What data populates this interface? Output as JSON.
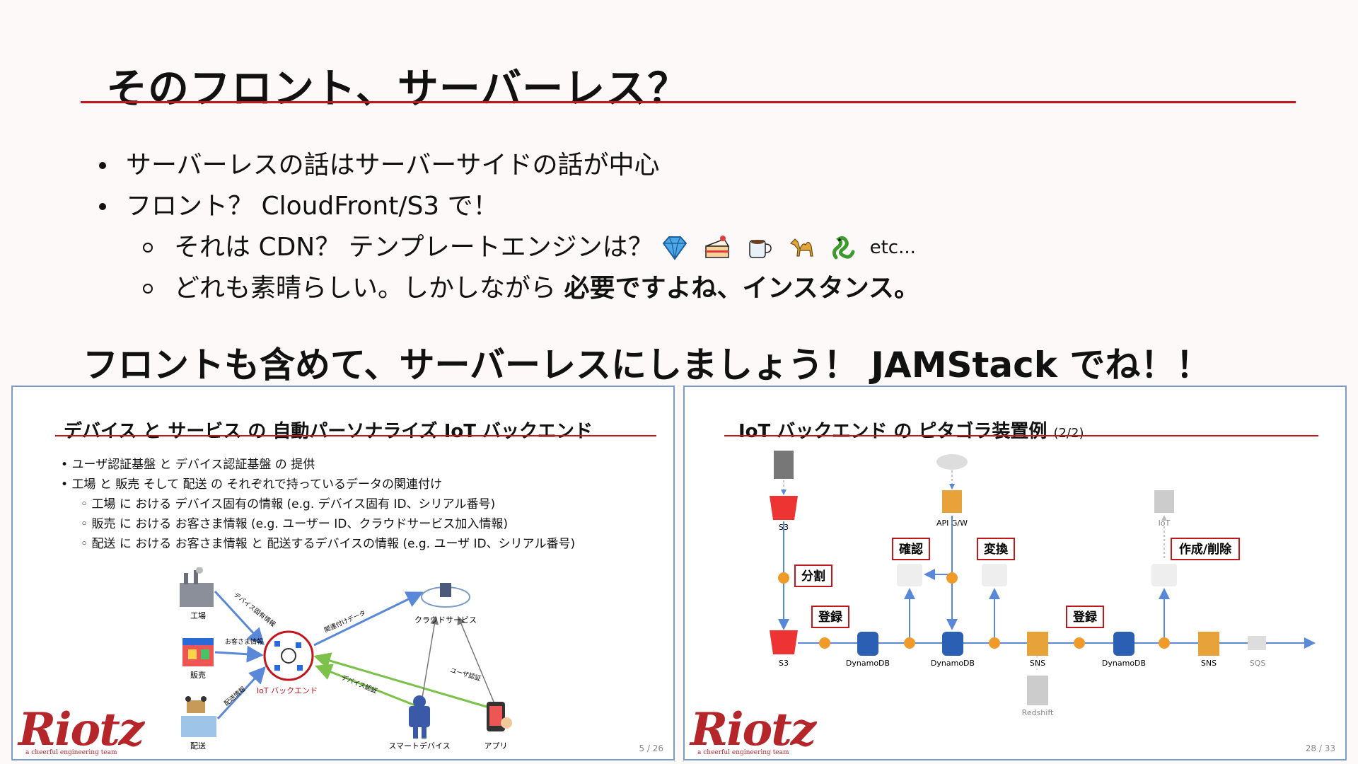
{
  "slide": {
    "title": "そのフロント、サーバーレス？",
    "bullets": [
      "サーバーレスの話はサーバーサイドの話が中心",
      "フロント？ CloudFront/S3 で！"
    ],
    "sub_bullet_1": "それは CDN？ テンプレートエンジンは？",
    "sub_bullet_1_etc": "etc...",
    "emoji_icons": [
      "gem-icon",
      "cake-icon",
      "coffee-icon",
      "camel-icon",
      "snake-icon"
    ],
    "sub_bullet_2_plain": "どれも素晴らしい。しかしながら",
    "sub_bullet_2_bold": "必要ですよね、インスタンス。",
    "headline": "フロントも含めて、サーバーレスにしましょう！ JAMStack でね！！"
  },
  "left_panel": {
    "title": "デバイス と サービス の 自動パーソナライズ IoT バックエンド",
    "bullets": [
      "ユーザ認証基盤 と デバイス認証基盤 の 提供",
      "工場 と 販売 そして 配送 の それぞれで持っているデータの関連付け"
    ],
    "sub_bullets": [
      "工場 に おける デバイス固有の情報 (e.g. デバイス固有 ID、シリアル番号)",
      "販売 に おける お客さま情報 (e.g. ユーザー ID、クラウドサービス加入情報)",
      "配送 に おける お客さま情報 と 配送するデバイスの情報 (e.g. ユーザ ID、シリアル番号)"
    ],
    "diagram": {
      "factory": "工場",
      "sales": "販売",
      "delivery": "配送",
      "backend": "IoT バックエンド",
      "cloud": "クラウドサービス",
      "smart_device": "スマートデバイス",
      "app": "アプリ",
      "edge_device_info": "デバイス固有情報",
      "edge_customer_info": "お客さま情報",
      "edge_delivery_info": "配送情報",
      "edge_assoc": "関連付けデータ",
      "edge_device_auth": "デバイス認証",
      "edge_user_auth": "ユーザ認証"
    },
    "logo": "Riotz",
    "logo_tagline": "a cheerful engineering team",
    "page": "5 / 26"
  },
  "right_panel": {
    "title": "IoT バックエンド の ピタゴラ装置例",
    "title_suffix": "(2/2)",
    "labels": {
      "s3_top": "S3",
      "s3_bottom": "S3",
      "api_gw": "API G/W",
      "iot": "IoT",
      "dynamo1": "DynamoDB",
      "dynamo2": "DynamoDB",
      "dynamo3": "DynamoDB",
      "sns1": "SNS",
      "sns2": "SNS",
      "sqs": "SQS",
      "redshift": "Redshift"
    },
    "callouts": {
      "split": "分割",
      "register1": "登録",
      "confirm": "確認",
      "convert": "変換",
      "register2": "登録",
      "create_delete": "作成/削除"
    },
    "logo": "Riotz",
    "logo_tagline": "a cheerful engineering team",
    "page": "28 / 33"
  }
}
